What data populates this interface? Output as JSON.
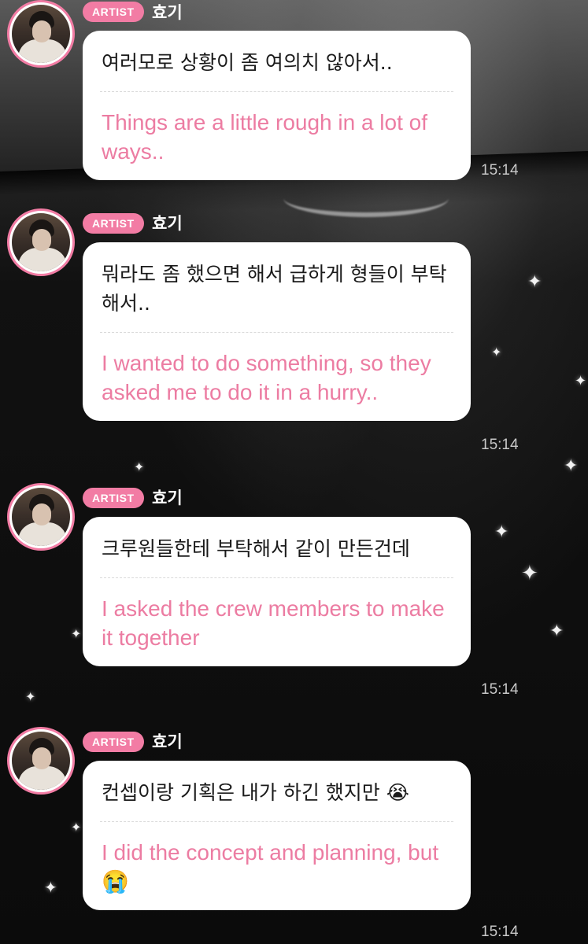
{
  "messages": [
    {
      "badge": "ARTIST",
      "sender": "효기",
      "original": "여러모로 상황이 좀 여의치 않아서..",
      "translation": "Things are a little rough in a lot of ways..",
      "time": "15:14"
    },
    {
      "badge": "ARTIST",
      "sender": "효기",
      "original": "뭐라도 좀 했으면 해서 급하게 형들이 부탁해서..",
      "translation": "I wanted to do something, so they asked me to do it in a hurry..",
      "time": "15:14"
    },
    {
      "badge": "ARTIST",
      "sender": "효기",
      "original": "크루원들한테 부탁해서 같이 만든건데",
      "translation": "I asked the crew members to make it together",
      "time": "15:14"
    },
    {
      "badge": "ARTIST",
      "sender": "효기",
      "original": "컨셉이랑 기획은 내가 하긴 했지만 😭",
      "translation": "I did the concept and planning, but 😭",
      "time": "15:14"
    }
  ],
  "theme": {
    "accent": "#f27ca4",
    "translation_color": "#ec7ca2",
    "bubble": "#ffffff"
  }
}
